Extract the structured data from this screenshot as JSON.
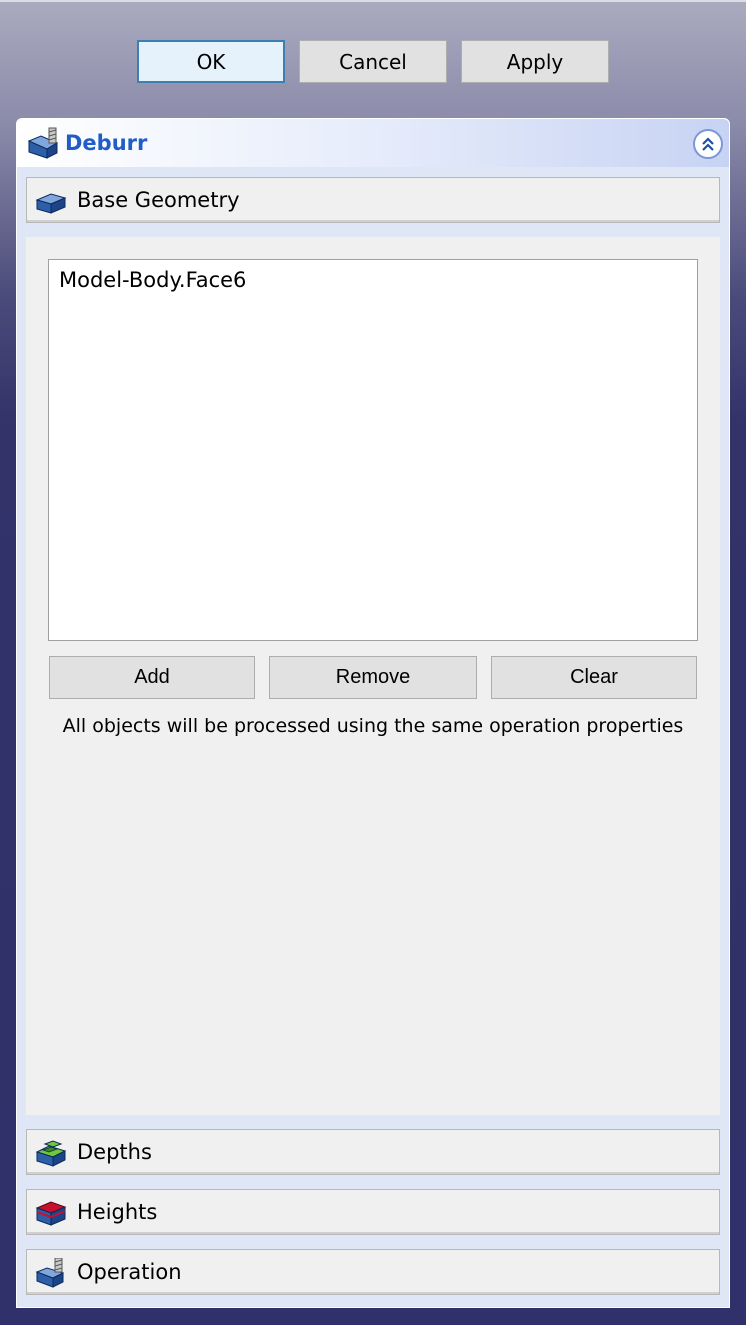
{
  "dialog_buttons": {
    "ok": "OK",
    "cancel": "Cancel",
    "apply": "Apply"
  },
  "panel": {
    "title": "Deburr",
    "icon": "deburr-tool-icon",
    "collapse_icon": "chevron-double-up-icon"
  },
  "sections": {
    "base_geometry": {
      "label": "Base Geometry",
      "icon": "base-geometry-icon"
    },
    "depths": {
      "label": "Depths",
      "icon": "depths-icon"
    },
    "heights": {
      "label": "Heights",
      "icon": "heights-icon"
    },
    "operation": {
      "label": "Operation",
      "icon": "operation-icon"
    }
  },
  "base_geometry": {
    "items": [
      "Model-Body.Face6"
    ],
    "add_label": "Add",
    "remove_label": "Remove",
    "clear_label": "Clear",
    "note": "All objects will be processed using the same operation properties"
  },
  "colors": {
    "title": "#215dc6",
    "heights_top": "#c8102e",
    "depths_face": "#6fc83a"
  }
}
